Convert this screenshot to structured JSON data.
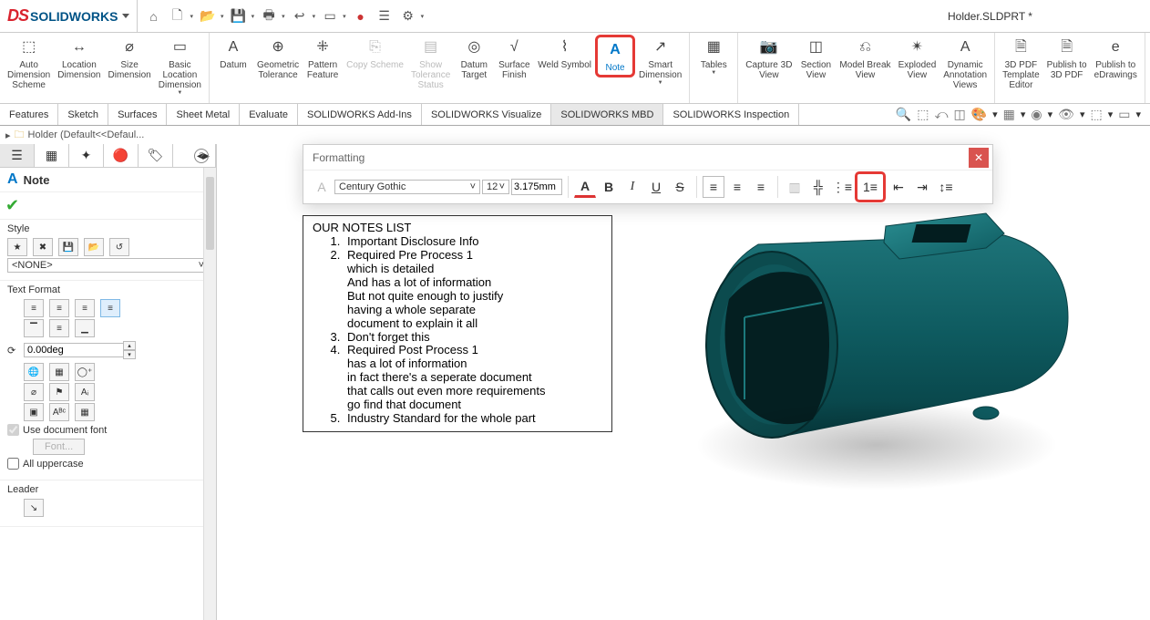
{
  "title": "Holder.SLDPRT *",
  "logo": {
    "ds": "DS",
    "name": "SOLIDWORKS"
  },
  "qat_icons": [
    "home",
    "new",
    "open",
    "save",
    "print",
    "undo",
    "select",
    "rebuild",
    "traffic",
    "options",
    "gear"
  ],
  "ribbon": {
    "groups": [
      [
        {
          "label": "Auto Dimension Scheme",
          "icon": "⬚"
        },
        {
          "label": "Location Dimension",
          "icon": "↔"
        },
        {
          "label": "Size Dimension",
          "icon": "⌀"
        },
        {
          "label": "Basic Location Dimension",
          "icon": "▭",
          "drop": true
        }
      ],
      [
        {
          "label": "Datum",
          "icon": "A"
        },
        {
          "label": "Geometric Tolerance",
          "icon": "⊕"
        },
        {
          "label": "Pattern Feature",
          "icon": "⁜"
        },
        {
          "label": "Copy Scheme",
          "icon": "⎘",
          "disabled": true
        },
        {
          "label": "Show Tolerance Status",
          "icon": "▤",
          "disabled": true
        },
        {
          "label": "Datum Target",
          "icon": "◎"
        },
        {
          "label": "Surface Finish",
          "icon": "√"
        },
        {
          "label": "Weld Symbol",
          "icon": "⌇"
        },
        {
          "label": "Note",
          "icon": "A",
          "highlight": true
        },
        {
          "label": "Smart Dimension",
          "icon": "↗",
          "drop": true
        }
      ],
      [
        {
          "label": "Tables",
          "icon": "▦",
          "drop": true
        }
      ],
      [
        {
          "label": "Capture 3D View",
          "icon": "📷"
        },
        {
          "label": "Section View",
          "icon": "◫"
        },
        {
          "label": "Model Break View",
          "icon": "⎌"
        },
        {
          "label": "Exploded View",
          "icon": "✴"
        },
        {
          "label": "Dynamic Annotation Views",
          "icon": "A"
        }
      ],
      [
        {
          "label": "3D PDF Template Editor",
          "icon": "🗎"
        },
        {
          "label": "Publish to 3D PDF",
          "icon": "🗎"
        },
        {
          "label": "Publish to eDrawings",
          "icon": "e"
        }
      ]
    ]
  },
  "tabs": [
    "Features",
    "Sketch",
    "Surfaces",
    "Sheet Metal",
    "Evaluate",
    "SOLIDWORKS Add-Ins",
    "SOLIDWORKS Visualize",
    "SOLIDWORKS MBD",
    "SOLIDWORKS Inspection"
  ],
  "active_tab": "SOLIDWORKS MBD",
  "crumb": "Holder  (Default<<Defaul...",
  "left": {
    "header": "Note",
    "sections": {
      "style": {
        "title": "Style",
        "selected": "<NONE>"
      },
      "textformat": {
        "title": "Text Format",
        "angle": "0.00deg",
        "use_doc_font": "Use document font",
        "font_btn": "Font...",
        "all_upper": "All uppercase"
      },
      "leader": {
        "title": "Leader"
      }
    }
  },
  "formatting": {
    "title": "Formatting",
    "font": "Century Gothic",
    "size": "12",
    "dim": "3.175mm"
  },
  "note_text": {
    "heading": "OUR NOTES LIST",
    "items": [
      [
        "Important Disclosure Info"
      ],
      [
        "Required Pre Process 1",
        "which is detailed",
        "And has a lot of information",
        "But not quite enough to justify",
        "having a whole separate",
        "document to explain it all"
      ],
      [
        "Don't forget this"
      ],
      [
        "Required Post Process 1",
        "has a lot of information",
        "in fact there's a seperate document",
        "that calls out even more requirements",
        "go find that document"
      ],
      [
        "Industry Standard for the whole part"
      ]
    ]
  }
}
